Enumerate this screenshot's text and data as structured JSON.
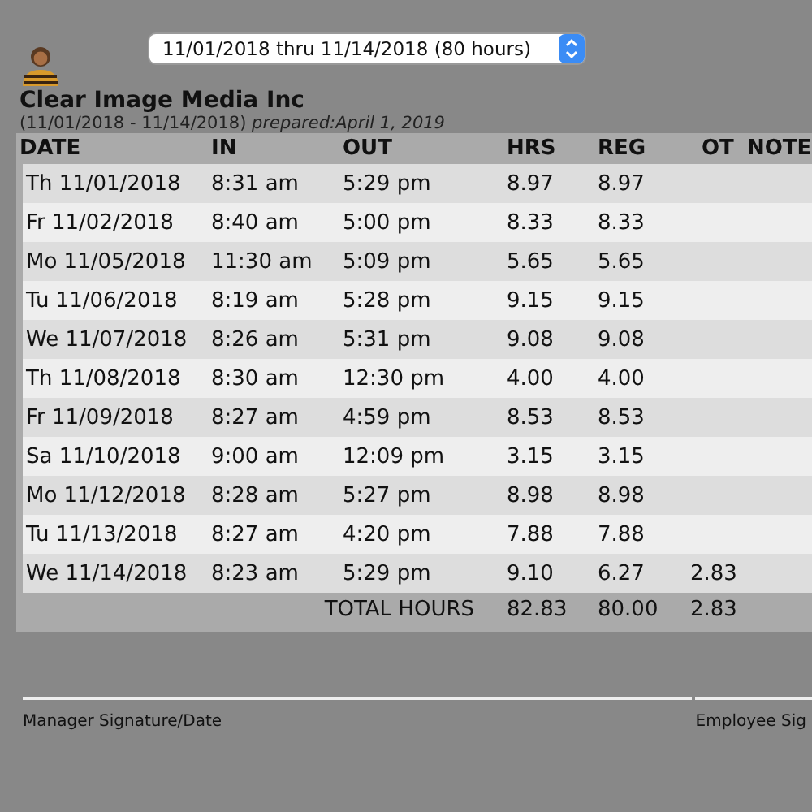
{
  "period_select": {
    "value": "11/01/2018 thru 11/14/2018 (80 hours)"
  },
  "company": "Clear Image Media Inc",
  "subtitle": {
    "range": "(11/01/2018 - 11/14/2018)",
    "prepared": "prepared:April 1, 2019"
  },
  "table": {
    "columns": [
      "DATE",
      "IN",
      "OUT",
      "HRS",
      "REG",
      "OT",
      "NOTE"
    ],
    "rows": [
      {
        "date": "Th 11/01/2018",
        "in": "8:31 am",
        "out": "5:29 pm",
        "hrs": "8.97",
        "reg": "8.97"
      },
      {
        "date": "Fr 11/02/2018",
        "in": "8:40 am",
        "out": "5:00 pm",
        "hrs": "8.33",
        "reg": "8.33"
      },
      {
        "date": "Mo 11/05/2018",
        "in": "11:30 am",
        "out": "5:09 pm",
        "hrs": "5.65",
        "reg": "5.65"
      },
      {
        "date": "Tu 11/06/2018",
        "in": "8:19 am",
        "out": "5:28 pm",
        "hrs": "9.15",
        "reg": "9.15"
      },
      {
        "date": "We 11/07/2018",
        "in": "8:26 am",
        "out": "5:31 pm",
        "hrs": "9.08",
        "reg": "9.08"
      },
      {
        "date": "Th 11/08/2018",
        "in": "8:30 am",
        "out": "12:30 pm",
        "hrs": "4.00",
        "reg": "4.00"
      },
      {
        "date": "Fr 11/09/2018",
        "in": "8:27 am",
        "out": "4:59 pm",
        "hrs": "8.53",
        "reg": "8.53"
      },
      {
        "date": "Sa 11/10/2018",
        "in": "9:00 am",
        "out": "12:09 pm",
        "hrs": "3.15",
        "reg": "3.15"
      },
      {
        "date": "Mo 11/12/2018",
        "in": "8:28 am",
        "out": "5:27 pm",
        "hrs": "8.98",
        "reg": "8.98"
      },
      {
        "date": "Tu 11/13/2018",
        "in": "8:27 am",
        "out": "4:20 pm",
        "hrs": "7.88",
        "reg": "7.88"
      },
      {
        "date": "We 11/14/2018",
        "in": "8:23 am",
        "out": "5:29 pm",
        "hrs": "9.10",
        "reg": "6.27",
        "ot": "2.83"
      }
    ],
    "total": {
      "label": "TOTAL HOURS",
      "hrs": "82.83",
      "reg": "80.00",
      "ot": "2.83"
    }
  },
  "signatures": [
    "Manager Signature/Date",
    "Employee Sig"
  ]
}
